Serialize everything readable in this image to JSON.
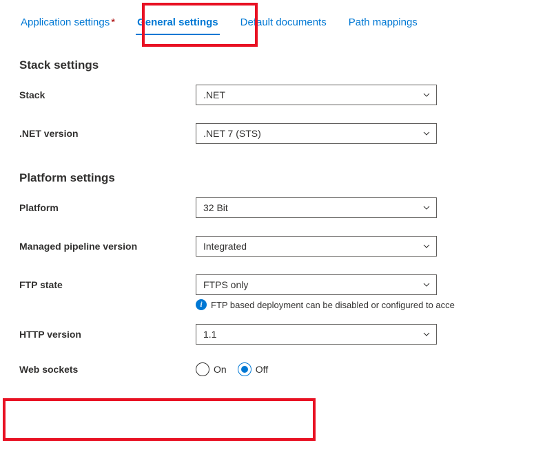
{
  "tabs": {
    "app_settings": "Application settings",
    "asterisk": "*",
    "general_settings": "General settings",
    "default_documents": "Default documents",
    "path_mappings": "Path mappings"
  },
  "stack_section": {
    "title": "Stack settings",
    "stack_label": "Stack",
    "stack_value": ".NET",
    "version_label": ".NET version",
    "version_value": ".NET 7 (STS)"
  },
  "platform_section": {
    "title": "Platform settings",
    "platform_label": "Platform",
    "platform_value": "32 Bit",
    "pipeline_label": "Managed pipeline version",
    "pipeline_value": "Integrated",
    "ftp_label": "FTP state",
    "ftp_value": "FTPS only",
    "ftp_info": "FTP based deployment can be disabled or configured to acce",
    "http_label": "HTTP version",
    "http_value": "1.1",
    "websockets_label": "Web sockets",
    "websockets_on": "On",
    "websockets_off": "Off"
  }
}
